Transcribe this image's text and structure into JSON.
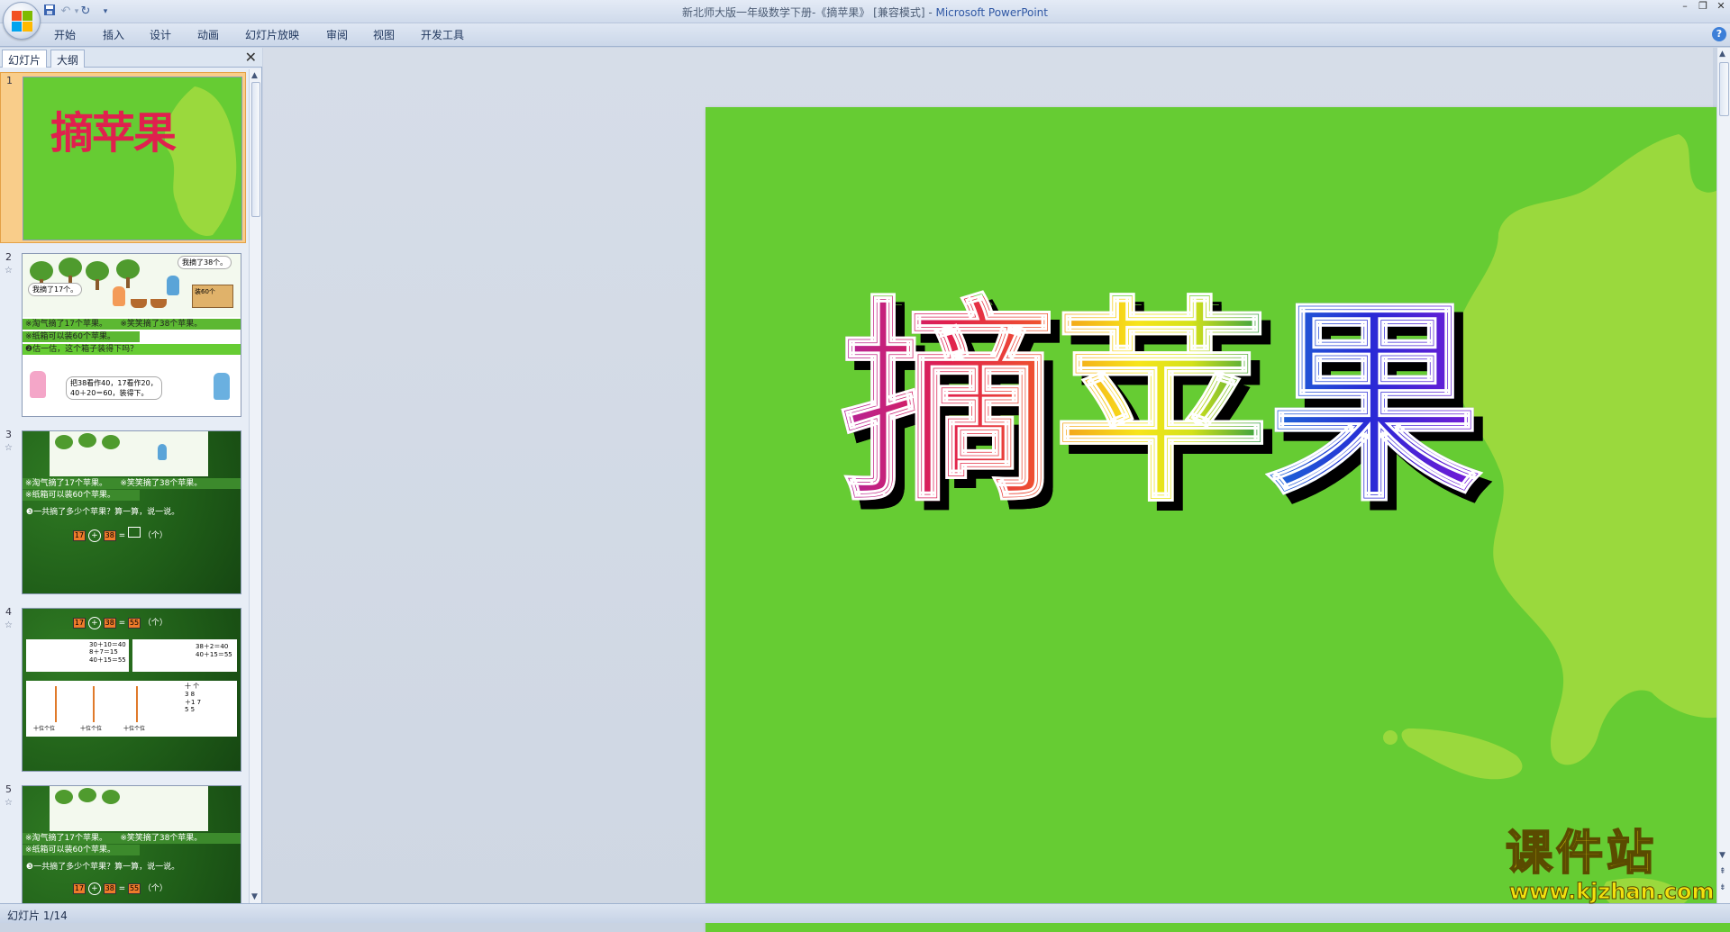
{
  "titlebar": {
    "doc_title": "新北师大版一年级数学下册-《摘苹果》 [兼容模式] - ",
    "app_name": "Microsoft PowerPoint"
  },
  "ribbon": {
    "tabs": [
      "开始",
      "插入",
      "设计",
      "动画",
      "幻灯片放映",
      "审阅",
      "视图",
      "开发工具"
    ]
  },
  "panel": {
    "tabs": [
      "幻灯片",
      "大纲"
    ],
    "close_glyph": "✕"
  },
  "thumbnails": [
    {
      "num": "1",
      "title": "摘苹果"
    },
    {
      "num": "2",
      "bubble_top": "我摘了38个。",
      "bubble_left": "我摘了17个。",
      "box_label": "装60个",
      "bar1": "※淘气摘了17个苹果。",
      "bar1b": "※笑笑摘了38个苹果。",
      "bar2": "※纸箱可以装60个苹果。",
      "question": "❷估一估，这个箱子装得下吗？",
      "bubble_bottom1": "把38看作40，17看作20，",
      "bubble_bottom2": "40＋20＝60，装得下。"
    },
    {
      "num": "3",
      "bar1": "※淘气摘了17个苹果。",
      "bar1b": "※笑笑摘了38个苹果。",
      "bar2": "※纸箱可以装60个苹果。",
      "question": "❸一共摘了多少个苹果？算一算，说一说。",
      "n1": "17",
      "op": "+",
      "n2": "38",
      "eq": "=",
      "unit": "（个）"
    },
    {
      "num": "4",
      "n1": "17",
      "op": "+",
      "n2": "38",
      "eq": "=",
      "result": "55",
      "unit": "（个）",
      "calc1": "30＋10＝40",
      "calc2": "8＋7＝15",
      "calc3": "40＋15＝55",
      "calc4": "38＋2＝40",
      "calc5": "40＋15＝55",
      "col_label1": "十位个位",
      "col_label2": "十位个位",
      "col_label3": "十位个位",
      "vert1": "十  个",
      "vert2": "3  8",
      "vert3": "＋1  7",
      "vert4": "5  5"
    },
    {
      "num": "5",
      "bar1": "※淘气摘了17个苹果。",
      "bar1b": "※笑笑摘了38个苹果。",
      "bar2": "※纸箱可以装60个苹果。",
      "question": "❸一共摘了多少个苹果？算一算，说一说。",
      "n1": "17",
      "op": "+",
      "n2": "38",
      "eq": "=",
      "result": "55",
      "unit": "（个）"
    }
  ],
  "slide": {
    "title_chars": [
      "摘",
      "苹",
      "果"
    ]
  },
  "statusbar": {
    "text": "幻灯片 1/14"
  },
  "watermark": {
    "cn": "课件站",
    "url": "www.kjzhan.com"
  },
  "colors": {
    "slide_bg": "#66cc33",
    "splash": "#9ad93d",
    "selection": "#f9cd8a"
  },
  "icons": {
    "office": "office-logo-icon",
    "save": "save-icon",
    "undo": "undo-icon",
    "redo": "redo-icon",
    "help": "help-icon"
  }
}
